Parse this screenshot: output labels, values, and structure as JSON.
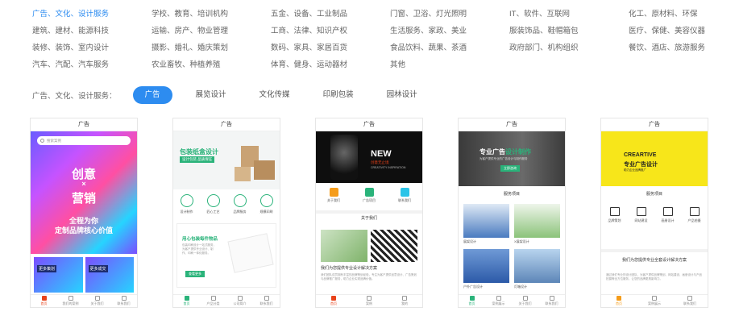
{
  "categories": [
    "广告、文化、设计服务",
    "学校、教育、培训机构",
    "五金、设备、工业制品",
    "门窗、卫浴、灯光照明",
    "IT、软件、互联网",
    "化工、原材料、环保",
    "建筑、建材、能源科技",
    "运输、房产、物业管理",
    "工商、法律、知识产权",
    "生活服务、家政、美业",
    "服装饰品、鞋帽箱包",
    "医疗、保健、美容仪器",
    "装修、装饰、室内设计",
    "摄影、婚礼、婚庆策划",
    "数码、家具、家居百货",
    "食品饮料、蔬果、茶酒",
    "政府部门、机构组织",
    "餐饮、酒店、旅游服务",
    "汽车、汽配、汽车服务",
    "农业畜牧、种植养殖",
    "体育、健身、运动器材",
    "其他"
  ],
  "active_category": "广告、文化、设计服务",
  "filter": {
    "label": "广告、文化、设计服务：",
    "pills": [
      "广告",
      "展览设计",
      "文化传媒",
      "印刷包装",
      "园林设计"
    ],
    "active": "广告"
  },
  "cards": [
    {
      "title": "广告",
      "search_placeholder": "搜索案例",
      "hero_lines": [
        "创意",
        "×",
        "营销",
        "全程为你",
        "定制品牌核心价值"
      ],
      "box_labels": [
        "更多策划",
        "更多成交"
      ],
      "tabs": [
        "首页",
        "我们的案例",
        "关于我们",
        "联系我们"
      ]
    },
    {
      "title": "广告",
      "hero_title": "包装纸盒设计",
      "hero_sub": "设计包装 品质保证",
      "icons": [
        "设计制作",
        "匠心工艺",
        "品牌服务",
        "规模印刷"
      ],
      "panel_title": "用心包装每件物品",
      "panel_text": "包装印刷设计一站式服务，为客户提供专业设计、制作、印刷一体化服务。",
      "panel_button": "查看更多",
      "tabs": [
        "首页",
        "产品分类",
        "公司简介",
        "联系我们"
      ]
    },
    {
      "title": "广告",
      "hero_big": "NEW",
      "hero_sub": "创意无止境",
      "hero_sub2": "CREATIVITY INSPIRATION",
      "icons": [
        "关于我们",
        "广告项目",
        "联系我们"
      ],
      "about": "关于我们",
      "head": "我们为您提供专业设计解决方案",
      "text": "我们团队成员拥有丰富的品牌策划经验，专注为客户提供创意设计、广告策划与品牌推广服务，助力企业实现品牌价值。",
      "tabs": [
        "首页",
        "案例",
        "我的"
      ]
    },
    {
      "title": "广告",
      "hero_title_a": "专业广告",
      "hero_title_b": "设计制作",
      "hero_sub": "为客户提供专业的广告设计与制作服务",
      "hero_button": "立即咨询",
      "services": "服务项目",
      "items": [
        "展架设计",
        "X展架设计",
        "户外广告设计",
        "灯箱设计"
      ],
      "tabs": [
        "首页",
        "案例展示",
        "关于我们",
        "联系我们"
      ]
    },
    {
      "title": "广告",
      "hero_t1": "CREARTIVE",
      "hero_t2": "专业广告设计",
      "hero_t3": "助力企业品牌推广",
      "services": "服务项目",
      "icons": [
        "品牌策划",
        "网站建设",
        "画册设计",
        "产品拍摄"
      ],
      "head": "我们为您提供专业全套设计解决方案",
      "text": "通过我们专业的设计团队，为客户提供品牌策划、网站建设、画册设计与产品拍摄等全方位服务，让您的品牌更具影响力。",
      "tabs": [
        "首页",
        "案例展示",
        "联系我们"
      ]
    }
  ],
  "colors": {
    "accent": "#2d8cf0",
    "green": "#2ab37a",
    "red": "#e8421a",
    "yellow": "#f7e61a"
  }
}
